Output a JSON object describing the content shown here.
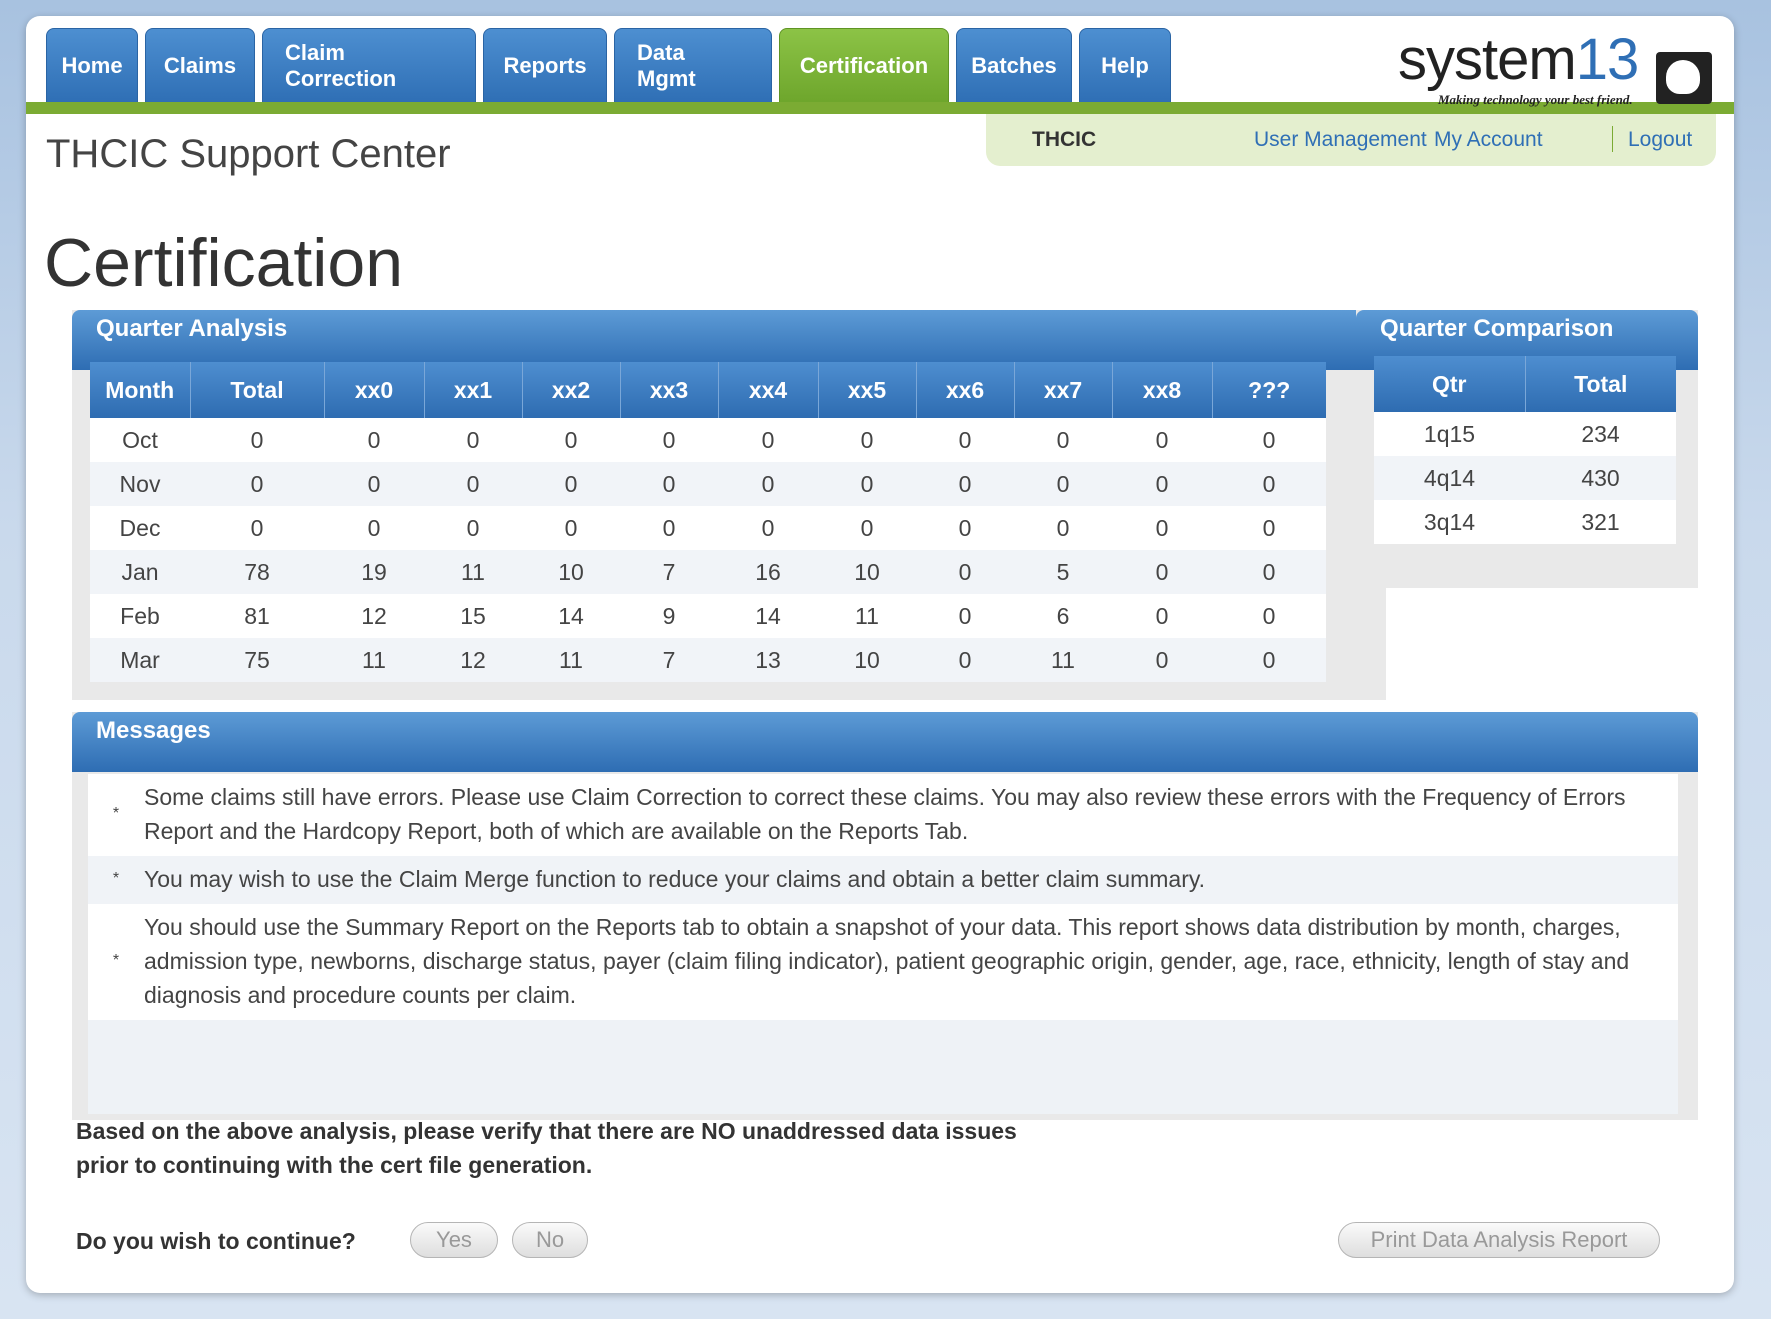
{
  "nav": {
    "tabs": [
      {
        "label": "Home"
      },
      {
        "label": "Claims"
      },
      {
        "label": "Claim Correction"
      },
      {
        "label": "Reports"
      },
      {
        "label": "Data Mgmt"
      },
      {
        "label": "Certification",
        "active": true
      },
      {
        "label": "Batches"
      },
      {
        "label": "Help"
      }
    ]
  },
  "logo": {
    "word_main": "system",
    "word_num": "13",
    "tagline": "Making technology your best friend."
  },
  "subbar": {
    "org": "THCIC",
    "links": [
      "User Management",
      "My Account",
      "Logout"
    ]
  },
  "site_title": "THCIC Support Center",
  "page_title": "Certification",
  "quarter_analysis": {
    "title": "Quarter Analysis",
    "columns": [
      "Month",
      "Total",
      "xx0",
      "xx1",
      "xx2",
      "xx3",
      "xx4",
      "xx5",
      "xx6",
      "xx7",
      "xx8",
      "???"
    ],
    "rows": [
      [
        "Oct",
        "0",
        "0",
        "0",
        "0",
        "0",
        "0",
        "0",
        "0",
        "0",
        "0",
        "0"
      ],
      [
        "Nov",
        "0",
        "0",
        "0",
        "0",
        "0",
        "0",
        "0",
        "0",
        "0",
        "0",
        "0"
      ],
      [
        "Dec",
        "0",
        "0",
        "0",
        "0",
        "0",
        "0",
        "0",
        "0",
        "0",
        "0",
        "0"
      ],
      [
        "Jan",
        "78",
        "19",
        "11",
        "10",
        "7",
        "16",
        "10",
        "0",
        "5",
        "0",
        "0"
      ],
      [
        "Feb",
        "81",
        "12",
        "15",
        "14",
        "9",
        "14",
        "11",
        "0",
        "6",
        "0",
        "0"
      ],
      [
        "Mar",
        "75",
        "11",
        "12",
        "11",
        "7",
        "13",
        "10",
        "0",
        "11",
        "0",
        "0"
      ]
    ]
  },
  "quarter_comparison": {
    "title": "Quarter Comparison",
    "columns": [
      "Qtr",
      "Total"
    ],
    "rows": [
      [
        "1q15",
        "234"
      ],
      [
        "4q14",
        "430"
      ],
      [
        "3q14",
        "321"
      ]
    ]
  },
  "messages": {
    "title": "Messages",
    "bullet": "*",
    "items": [
      "Some claims still have errors. Please use Claim Correction to correct these claims. You may also review these errors with the Frequency of Errors Report and the Hardcopy Report, both of which are available on the Reports Tab.",
      "You may wish to use the Claim Merge function to reduce your claims and obtain a better claim summary.",
      "You should use the Summary Report on the Reports tab to obtain a snapshot of your data. This report shows data distribution by month, charges, admission type, newborns, discharge status, payer (claim filing indicator), patient geographic origin, gender, age, race, ethnicity, length of stay and diagnosis and procedure counts per claim."
    ]
  },
  "verify": {
    "line1": "Based on the above analysis, please verify that there are NO unaddressed data issues",
    "line2": "prior to continuing with the cert file generation."
  },
  "continue": {
    "question": "Do you wish to continue?",
    "yes_label": "Yes",
    "no_label": "No"
  },
  "print_label": "Print Data Analysis Report"
}
